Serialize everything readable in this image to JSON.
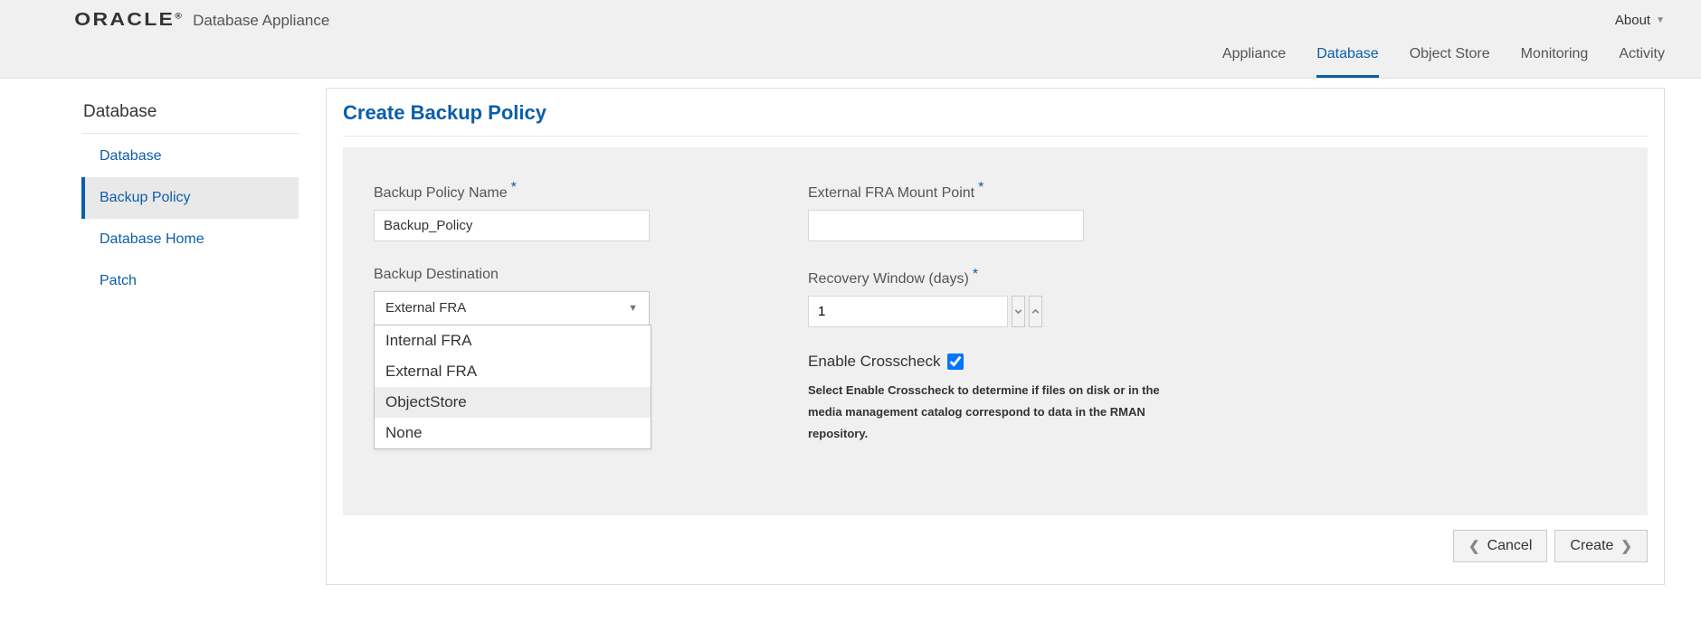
{
  "header": {
    "brand": "ORACLE",
    "product": "Database Appliance",
    "about_label": "About"
  },
  "topnav": {
    "items": [
      {
        "label": "Appliance",
        "active": false
      },
      {
        "label": "Database",
        "active": true
      },
      {
        "label": "Object Store",
        "active": false
      },
      {
        "label": "Monitoring",
        "active": false
      },
      {
        "label": "Activity",
        "active": false
      }
    ]
  },
  "sidebar": {
    "heading": "Database",
    "items": [
      {
        "label": "Database",
        "active": false
      },
      {
        "label": "Backup Policy",
        "active": true
      },
      {
        "label": "Database Home",
        "active": false
      },
      {
        "label": "Patch",
        "active": false
      }
    ]
  },
  "page": {
    "title": "Create Backup Policy"
  },
  "form": {
    "policy_name_label": "Backup Policy Name",
    "policy_name_value": "Backup_Policy",
    "destination_label": "Backup Destination",
    "destination_selected": "External FRA",
    "destination_options": [
      "Internal FRA",
      "External FRA",
      "ObjectStore",
      "None"
    ],
    "destination_highlight_index": 2,
    "mount_label": "External FRA Mount Point",
    "mount_value": "",
    "recovery_label": "Recovery Window (days)",
    "recovery_value": "1",
    "crosscheck_label": "Enable Crosscheck",
    "crosscheck_checked": true,
    "help": "Select Enable Crosscheck to determine if files on disk or in the media management catalog correspond to data in the RMAN repository."
  },
  "actions": {
    "cancel": "Cancel",
    "create": "Create"
  }
}
